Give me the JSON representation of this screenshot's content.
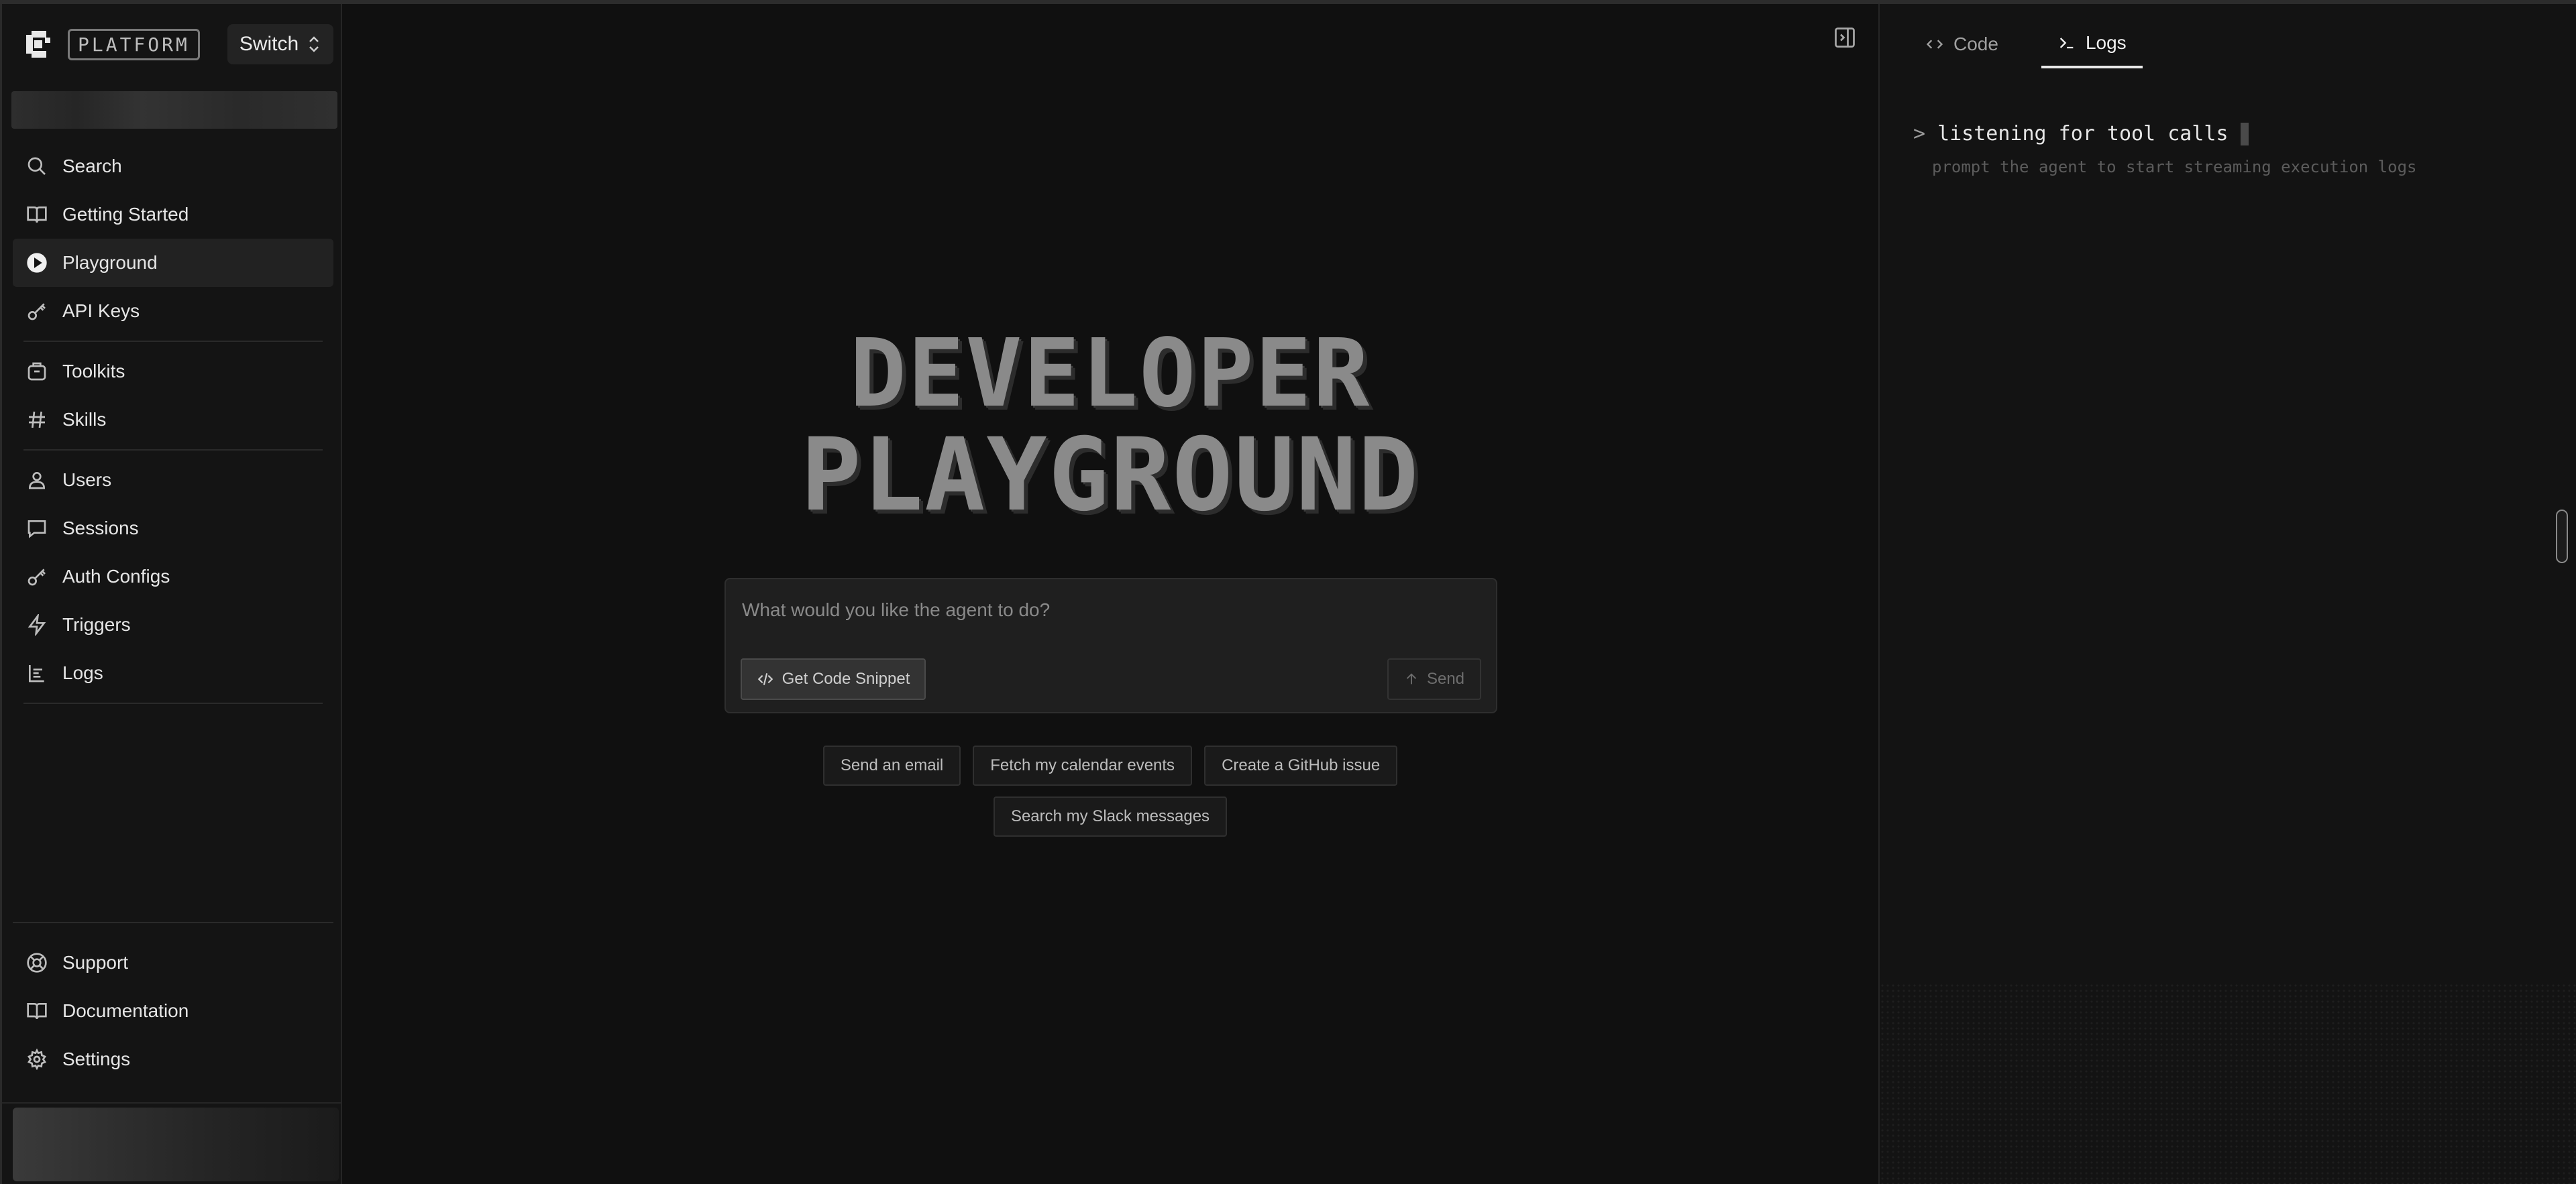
{
  "brand": {
    "name": "PLATFORM",
    "switch_label": "Switch"
  },
  "sidebar": {
    "group1": [
      {
        "label": "Search",
        "icon": "search-icon"
      },
      {
        "label": "Getting Started",
        "icon": "book-icon"
      },
      {
        "label": "Playground",
        "icon": "play-icon",
        "active": true
      },
      {
        "label": "API Keys",
        "icon": "key-icon"
      }
    ],
    "group2": [
      {
        "label": "Toolkits",
        "icon": "toolkit-icon"
      },
      {
        "label": "Skills",
        "icon": "hash-icon"
      }
    ],
    "group3": [
      {
        "label": "Users",
        "icon": "user-icon"
      },
      {
        "label": "Sessions",
        "icon": "chat-icon"
      },
      {
        "label": "Auth Configs",
        "icon": "key-icon"
      },
      {
        "label": "Triggers",
        "icon": "bolt-icon"
      },
      {
        "label": "Logs",
        "icon": "logs-icon"
      }
    ],
    "footer": [
      {
        "label": "Support",
        "icon": "lifebuoy-icon"
      },
      {
        "label": "Documentation",
        "icon": "book-icon"
      },
      {
        "label": "Settings",
        "icon": "gear-icon"
      }
    ]
  },
  "main": {
    "title_line1": "DEVELOPER",
    "title_line2": "PLAYGROUND",
    "prompt_placeholder": "What would you like the agent to do?",
    "code_snippet_label": "Get Code Snippet",
    "send_label": "Send",
    "suggestions_row1": [
      "Send an email",
      "Fetch my calendar events",
      "Create a GitHub issue"
    ],
    "suggestions_row2": [
      "Search my Slack messages"
    ]
  },
  "panel": {
    "tabs": [
      {
        "label": "Code",
        "icon": "code-icon"
      },
      {
        "label": "Logs",
        "icon": "terminal-icon",
        "active": true
      }
    ],
    "terminal_line": "listening for tool calls",
    "terminal_prompt": ">",
    "terminal_hint": "prompt the agent to start streaming execution logs"
  }
}
